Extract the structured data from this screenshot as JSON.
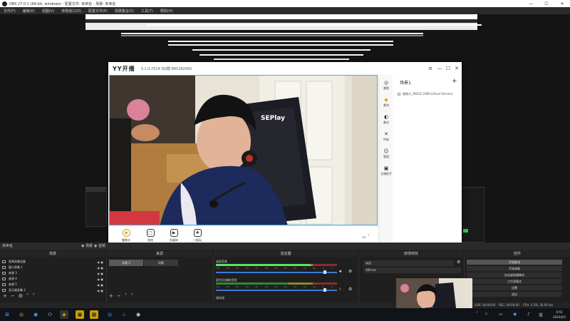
{
  "obs": {
    "title": "OBS 27.0.1 (64-bit, windows) - 配置文件: 未命名 - 场景: 未命名",
    "menu": [
      "文件(F)",
      "编辑(E)",
      "视图(V)",
      "停靠窗口(D)",
      "配置文件(P)",
      "场景集合(S)",
      "工具(T)",
      "帮助(H)"
    ],
    "window_controls": [
      "—",
      "☐",
      "✕"
    ],
    "dock_tab_scenes": "未命名",
    "dock_tab_sources": "◉ 场景",
    "dock_tab_audio": "◉ 音频",
    "docks": {
      "scenes": "场景",
      "sources": "来源",
      "mixer": "混音器",
      "transitions": "转场特效",
      "controls": "控件"
    },
    "scenes": [
      {
        "name": "视频采集设备"
      },
      {
        "name": "窗口采集 1"
      },
      {
        "name": "来源 3"
      },
      {
        "name": "来源 4"
      },
      {
        "name": "来源 5"
      },
      {
        "name": "显示器采集 2"
      }
    ],
    "source_buttons": [
      "场景 2",
      "场景"
    ],
    "mixer": [
      {
        "name": "桌面音频",
        "level": 0.78,
        "volume": 0.9
      },
      {
        "name": "麦克风/辅助音频",
        "level": 0.0,
        "volume": 0.9,
        "muted": true
      },
      {
        "name": "媒体源"
      }
    ],
    "meter_ticks": [
      "-60",
      "-55",
      "-50",
      "-45",
      "-40",
      "-35",
      "-30",
      "-25",
      "-20",
      "-15",
      "-10",
      "-5",
      "0"
    ],
    "transition": {
      "type": "淡出",
      "duration": "300 ms"
    },
    "controls": [
      "开始推流",
      "开始录制",
      "启动虚拟摄像机",
      "工作室模式",
      "设置",
      "退出"
    ],
    "status": {
      "live": "LIVE: 00:00:00",
      "rec": "REC: 00:00:00",
      "cpu": "CPU: 4.3%, 30.00 fps"
    }
  },
  "yy": {
    "logo": "YY开播",
    "version": "3.1.0.2524  QQ群:865182492",
    "sidebar": [
      {
        "label": "美颜",
        "icon": "◎"
      },
      {
        "label": "素材",
        "icon": "◆",
        "active": true
      },
      {
        "label": "美化",
        "icon": "◐"
      },
      {
        "label": "特效",
        "icon": "✕"
      },
      {
        "label": "管理",
        "icon": "☺"
      },
      {
        "label": "主播助手",
        "icon": "▣"
      }
    ],
    "scene_title": "场景1",
    "source_item": "摄像头_OBS22 (OBS-Virtual Stream)",
    "bottom": [
      {
        "label": "摄像头",
        "icon": "◉"
      },
      {
        "label": "游戏",
        "icon": "▢"
      },
      {
        "label": "多媒体",
        "icon": "▶"
      },
      {
        "label": "一起玩",
        "icon": "✚"
      }
    ],
    "window_controls": [
      "≡",
      "—",
      "☐",
      "✕"
    ]
  },
  "taskbar": {
    "icons": [
      "⊞",
      "◎",
      "◉",
      "⚇",
      "◈",
      "▣",
      "▦",
      "◎",
      "♨",
      "◉"
    ],
    "tray": [
      "ˆ",
      "⚐",
      "▭",
      "◉",
      "♪",
      "英"
    ],
    "time": "0:55",
    "date": "2024/4/3"
  },
  "colors": {
    "accent": "#3fa9f5",
    "yy_yellow": "#d6a500",
    "mute_red": "#e03030",
    "meter_green": "#5ee35e"
  }
}
